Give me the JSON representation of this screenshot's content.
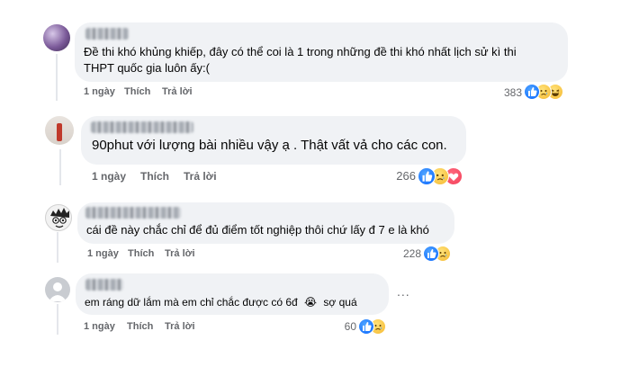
{
  "actions": {
    "like": "Thích",
    "reply": "Trả lời"
  },
  "comments": [
    {
      "author": "redacted",
      "text_line1": "Đề thi khó khủng khiếp, đây có thể coi là 1 trong những đề thi khó nhất lịch sử kì thi",
      "text_line2": "THPT quốc gia luôn ấy:(",
      "time": "1 ngày",
      "reaction_count": "383",
      "reactions": [
        "like",
        "sad",
        "haha"
      ]
    },
    {
      "author": "redacted",
      "text_line1": "90phut với lượng bài nhiều vậy ạ . Thật vất vả cho các con.",
      "time": "1 ngày",
      "reaction_count": "266",
      "reactions": [
        "like",
        "sad",
        "love"
      ]
    },
    {
      "author": "redacted",
      "text_line1": "cái đề này chắc chỉ để đủ điểm tốt nghiệp thôi chứ lấy đ 7 e là khó",
      "time": "1 ngày",
      "reaction_count": "228",
      "reactions": [
        "like",
        "sad"
      ]
    },
    {
      "author": "redacted",
      "text_line1": "em ráng dữ lắm mà em chỉ chắc được có 6đ",
      "emoji": "😭",
      "text_tail": "sợ quá",
      "time": "1 ngày",
      "reaction_count": "60",
      "reactions": [
        "like",
        "sad"
      ]
    }
  ],
  "more_options": "...",
  "icons": {
    "default_avatar": "default-avatar-icon",
    "more": "more-options-icon"
  },
  "colors": {
    "like": "#0866ff",
    "love": "#f33e58",
    "bubble": "#f0f2f5",
    "meta": "#65676b"
  }
}
